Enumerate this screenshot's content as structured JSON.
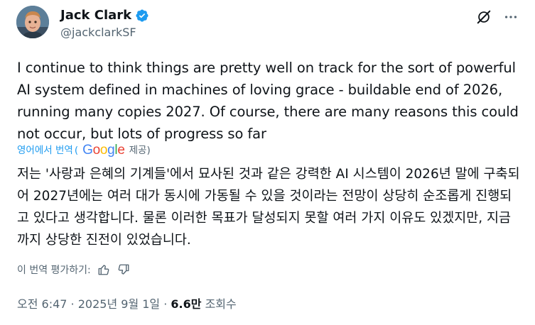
{
  "author": {
    "name": "Jack Clark",
    "handle": "@jackclarkSF",
    "verified_color": "#1d9bf0"
  },
  "top_actions": {
    "icons": [
      "grok-icon",
      "more-icon"
    ]
  },
  "tweet": {
    "text": "I continue to think things are pretty well on track for the sort of powerful AI system defined in machines of loving grace - buildable end of 2026, running many copies 2027. Of course, there are many reasons this could not occur, but lots of progress so far"
  },
  "translation": {
    "link_label": "영어에서 번역",
    "open_paren": "(",
    "provider_prefix": "",
    "provider_suffix": "제공)",
    "google_letters": [
      "G",
      "o",
      "o",
      "g",
      "l",
      "e"
    ],
    "text": "저는 '사랑과 은혜의 기계들'에서 묘사된 것과 같은 강력한 AI 시스템이 2026년 말에 구축되어 2027년에는 여러 대가 동시에 가동될 수 있을 것이라는 전망이 상당히 순조롭게 진행되고 있다고 생각합니다. 물론 이러한 목표가 달성되지 못할 여러 가지 이유도 있겠지만, 지금까지 상당한 진전이 있었습니다.",
    "rate_label": "이 번역 평가하기:"
  },
  "meta": {
    "time": "오전 6:47",
    "separator": " · ",
    "date": "2025년 9월 1일",
    "views_count": "6.6만",
    "views_label": " 조회수"
  },
  "colors": {
    "accent": "#1d9bf0",
    "text_primary": "#0f1419",
    "text_secondary": "#536471"
  }
}
